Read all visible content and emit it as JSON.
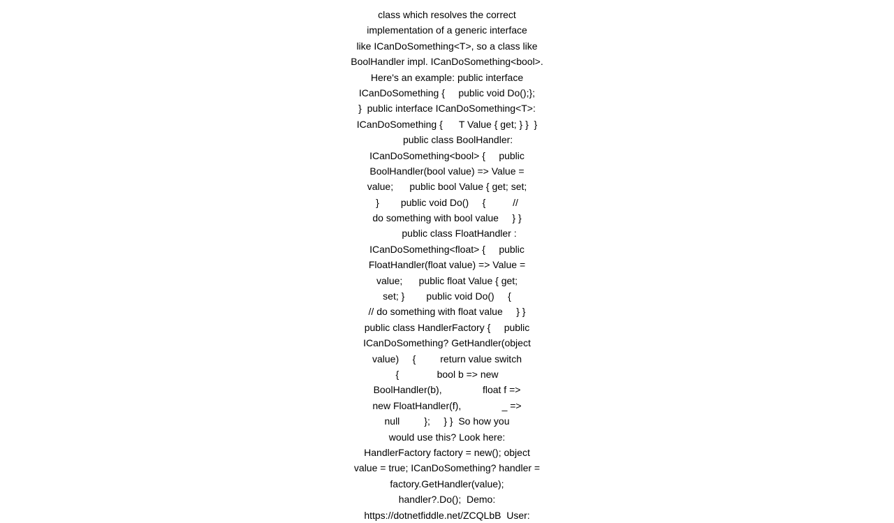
{
  "content": {
    "paragraphs": [
      "class which resolves the correct implementation of a generic interface like ICanDoSomething<T>, so a class like BoolHandler impl. ICanDoSomething<bool>.",
      "Here's an example: public interface ICanDoSomething {    public void Do(); }  public interface ICanDoSomething<T>: ICanDoSomething {      T Value { get; } }        public class BoolHandler: ICanDoSomething<bool> {    public BoolHandler(bool value) => Value = value;      public bool Value { get; set; }        public void Do()    {        // do something with bool value    } }        public class FloatHandler : ICanDoSomething<float> {    public FloatHandler(float value) => Value = value;      public float Value { get; set; }        public void Do()    {        // do something with float value    } }        public class HandlerFactory {    public ICanDoSomething? GetHandler(object value)    {        return value switch        {            bool b => new BoolHandler(b),            float f => new FloatHandler(f),            _ => null        };    } }  So how you would use this? Look here: HandlerFactory factory = new(); object value = true; ICanDoSomething? handler = factory.GetHandler(value); handler?.Do();  Demo: https://dotnetfiddle.net/ZCQLbB  User:"
    ]
  }
}
